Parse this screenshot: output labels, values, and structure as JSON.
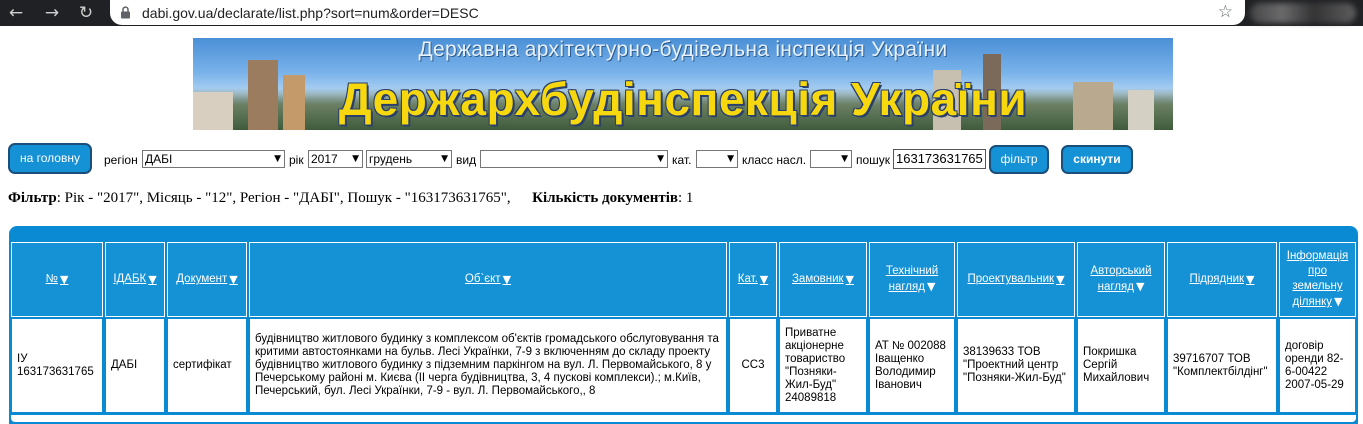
{
  "browser": {
    "url": "dabi.gov.ua/declarate/list.php?sort=num&order=DESC"
  },
  "banner": {
    "subtitle": "Державна архітектурно-будівельна інспекція України",
    "title": "Держархбудінспекція України"
  },
  "toolbar": {
    "home_label": "на головну",
    "region_label": "регіон",
    "region_value": "ДАБІ",
    "year_label": "рік",
    "year_value": "2017",
    "month_value": "грудень",
    "kind_label": "вид",
    "kind_value": "",
    "cat_label": "кат.",
    "cat_value": "",
    "class_label": "класс насл.",
    "class_value": "",
    "search_label": "пошук",
    "search_value": "163173631765",
    "filter_label": "фільтр",
    "reset_label": "скинути"
  },
  "summary": {
    "filter_label": "Фільтр",
    "filter_text": ": Рік - \"2017\", Місяць - \"12\", Регіон - \"ДАБІ\", Пошук - \"163173631765\",",
    "count_label": "Кількість документів",
    "count_text": ": 1"
  },
  "table": {
    "headers": [
      "№",
      "ІДАБК",
      "Документ",
      "Об`єкт",
      "Кат.",
      "Замовник",
      "Технічний нагляд",
      "Проектувальник",
      "Авторський нагляд",
      "Підрядник",
      "Інформація про земельну ділянку"
    ],
    "row": [
      "ІУ 163173631765",
      "ДАБІ",
      "сертифікат",
      "будівництво житлового будинку з комплексом об'єктів громадського обслуговування та критими автостоянками на бульв. Лесі Українки, 7-9 з включенням до складу проекту будівництво житлового будинку з підземним паркінгом на вул. Л. Первомайського, 8 у Печерському районі м. Києва (ІІ черга будівництва, 3, 4 пускові комплекси).; м.Київ, Печерський, бул. Лесі Українки, 7-9 - вул. Л. Первомайського,, 8",
      "СС3",
      "Приватне акціонерне товариство \"Позняки-Жил-Буд\" 24089818",
      "АТ № 002088 Іващенко Володимир Іванович",
      "38139633 ТОВ \"Проектний центр \"Позняки-Жил-Буд\"",
      "Покришка Сергій Михайлович",
      "39716707 ТОВ \"Комплектбілдінг\"",
      "договір оренди 82-6-00422 2007-05-29"
    ]
  },
  "colors": {
    "accent": "#1591d6",
    "table_border": "#0b8ad4",
    "banner_title": "#f7d80f"
  }
}
